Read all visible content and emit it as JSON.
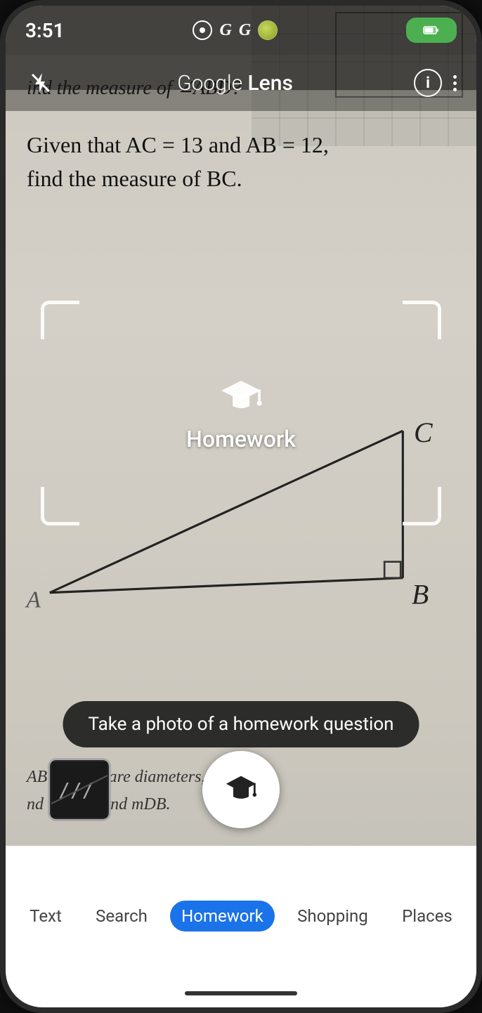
{
  "statusBar": {
    "time": "3:51",
    "batteryColor": "#4CAF50"
  },
  "header": {
    "title": "Google Lens",
    "titleGoogle": "Google",
    "titleLens": " Lens"
  },
  "camera": {
    "tooltip": "Take a photo of a homework question",
    "math_line1": "ind the measure of ∠ABD?",
    "math_question": "Given that AC = 13 and AB = 12,\nfind the measure of BC.",
    "triangle_label_c": "C",
    "triangle_label_b": "B",
    "triangle_label_a": "A",
    "bottom_text1": "AB and CD are diameters, and m",
    "bottom_text2": "nd m",
    "bottom_text3": "AD, and mDB."
  },
  "viewfinder": {
    "mode_label": "Homework"
  },
  "tabs": [
    {
      "id": "translate",
      "label": ""
    },
    {
      "id": "text",
      "label": "Text"
    },
    {
      "id": "search",
      "label": "Search"
    },
    {
      "id": "homework",
      "label": "Homework",
      "active": true
    },
    {
      "id": "shopping",
      "label": "Shopping"
    },
    {
      "id": "places",
      "label": "Places"
    }
  ]
}
